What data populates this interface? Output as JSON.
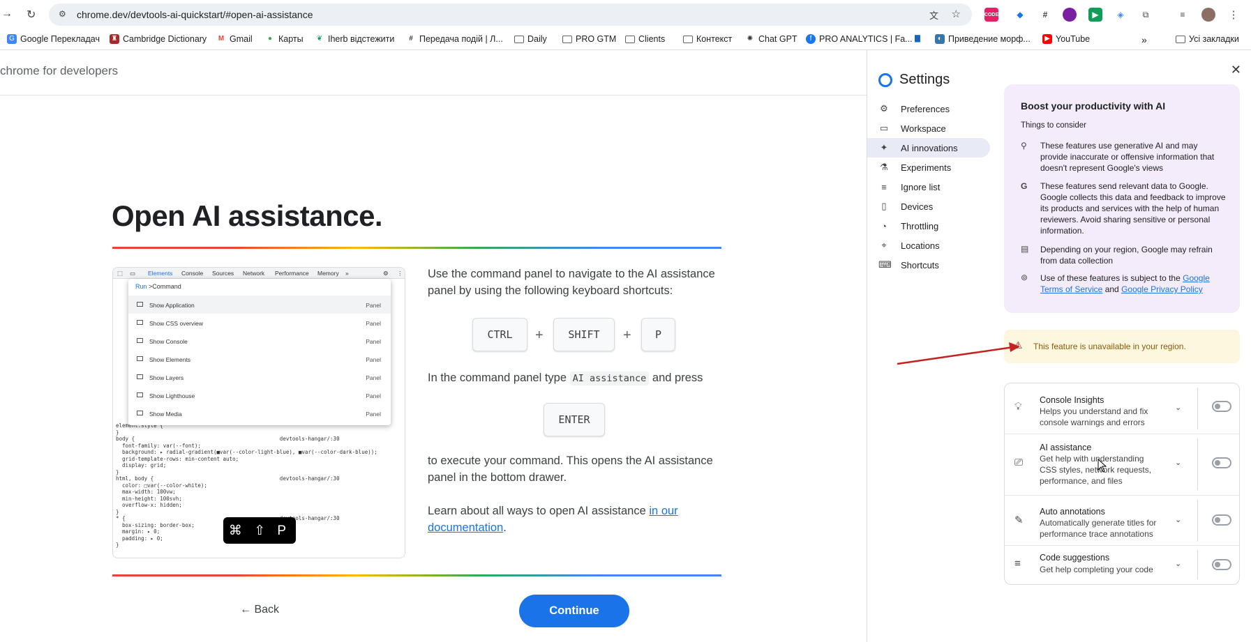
{
  "browser": {
    "url": "chrome.dev/devtools-ai-quickstart/#open-ai-assistance",
    "extensions": [
      "CODE"
    ]
  },
  "bookmarks": [
    {
      "label": "Google Перекладач",
      "icon": "google-translate-icon"
    },
    {
      "label": "Cambridge Dictionary",
      "icon": "cambridge-icon"
    },
    {
      "label": "Gmail",
      "icon": "gmail-icon"
    },
    {
      "label": "Карты",
      "icon": "maps-icon"
    },
    {
      "label": "Iherb відстежити",
      "icon": "iherb-icon"
    },
    {
      "label": "Передача подій | Л...",
      "icon": "hash-icon"
    },
    {
      "label": "Daily",
      "icon": "folder-icon"
    },
    {
      "label": "PRO GTM",
      "icon": "folder-icon"
    },
    {
      "label": "Clients",
      "icon": "folder-icon"
    },
    {
      "label": "Контекст",
      "icon": "folder-icon"
    },
    {
      "label": "Chat GPT",
      "icon": "openai-icon"
    },
    {
      "label": "PRO ANALYTICS | Fa...",
      "icon": "facebook-icon"
    },
    {
      "label": "Приведение морф...",
      "icon": "python-icon"
    },
    {
      "label": "YouTube",
      "icon": "youtube-icon"
    },
    {
      "label": "Усі закладки",
      "icon": "folder-icon"
    }
  ],
  "site": {
    "name": "chrome for developers"
  },
  "main": {
    "title": "Open AI assistance.",
    "p1": "Use the command panel to navigate to the AI assistance panel by using the following keyboard shortcuts:",
    "keys": [
      "CTRL",
      "SHIFT",
      "P"
    ],
    "plus": "+",
    "p2_before": "In the command panel type",
    "p2_code": "AI assistance",
    "p2_after": "and press",
    "enter_key": "ENTER",
    "p3": "to execute your command. This opens the AI assistance panel in the bottom drawer.",
    "p4_before": "Learn about all ways to open AI assistance",
    "p4_link": "in our documentation",
    "p4_after": ".",
    "back": "← Back",
    "continue": "Continue"
  },
  "screenshot": {
    "tabs": [
      "Elements",
      "Console",
      "Sources",
      "Network",
      "Performance",
      "Memory",
      "»"
    ],
    "run_label": "Run",
    "command_input": ">Command",
    "commands": [
      {
        "name": "Show Application",
        "type": "Panel"
      },
      {
        "name": "Show CSS overview",
        "type": "Panel"
      },
      {
        "name": "Show Console",
        "type": "Panel"
      },
      {
        "name": "Show Elements",
        "type": "Panel"
      },
      {
        "name": "Show Layers",
        "type": "Panel"
      },
      {
        "name": "Show Lighthouse",
        "type": "Panel"
      },
      {
        "name": "Show Media",
        "type": "Panel"
      }
    ],
    "code_lines": "element.style {\n}\nbody {                                              devtools-hangar/:30\n  font-family: var(--font);\n  background: ▸ radial-gradient(■var(--color-light-blue), ■var(--color-dark-blue));\n  grid-template-rows: min-content auto;\n  display: grid;\n}\nhtml, body {                                        devtools-hangar/:30\n  color: □var(--color-white);\n  max-width: 100vw;\n  min-height: 100svh;\n  overflow-x: hidden;\n}\n* {                                                 devtools-hangar/:30\n  box-sizing: border-box;\n  margin: ▸ 0;\n  padding: ▸ 0;\n}",
    "shortcut_badge": "⌘ ⇧ P"
  },
  "settings": {
    "title": "Settings",
    "nav": [
      {
        "label": "Preferences",
        "icon": "gear-icon"
      },
      {
        "label": "Workspace",
        "icon": "folder-icon"
      },
      {
        "label": "AI innovations",
        "icon": "sparkle-icon",
        "active": true
      },
      {
        "label": "Experiments",
        "icon": "flask-icon"
      },
      {
        "label": "Ignore list",
        "icon": "ignore-list-icon"
      },
      {
        "label": "Devices",
        "icon": "devices-icon"
      },
      {
        "label": "Throttling",
        "icon": "speedometer-icon"
      },
      {
        "label": "Locations",
        "icon": "pin-icon"
      },
      {
        "label": "Shortcuts",
        "icon": "keyboard-icon"
      }
    ],
    "ai_box": {
      "heading": "Boost your productivity with AI",
      "sub": "Things to consider",
      "points": [
        "These features use generative AI and may provide inaccurate or offensive information that doesn't represent Google's views",
        "These features send relevant data to Google. Google collects this data and feedback to improve its products and services with the help of human reviewers. Avoid sharing sensitive or personal information.",
        "Depending on your region, Google may refrain from data collection"
      ],
      "terms_before": "Use of these features is subject to the",
      "terms_link1": "Google Terms of Service",
      "terms_and": "and",
      "terms_link2": "Google Privacy Policy"
    },
    "warning": "This feature is unavailable in your region.",
    "features": [
      {
        "name": "Console Insights",
        "desc": "Helps you understand and fix console warnings and errors",
        "enabled": false
      },
      {
        "name": "AI assistance",
        "desc": "Get help with understanding CSS styles, network requests, performance, and files",
        "enabled": false
      },
      {
        "name": "Auto annotations",
        "desc": "Automatically generate titles for performance trace annotations",
        "enabled": false
      },
      {
        "name": "Code suggestions",
        "desc": "Get help completing your code",
        "enabled": false
      }
    ]
  },
  "colors": {
    "accent": "#1a73e8",
    "warning_bg": "#fef7e0",
    "arrow": "#c5221f"
  }
}
